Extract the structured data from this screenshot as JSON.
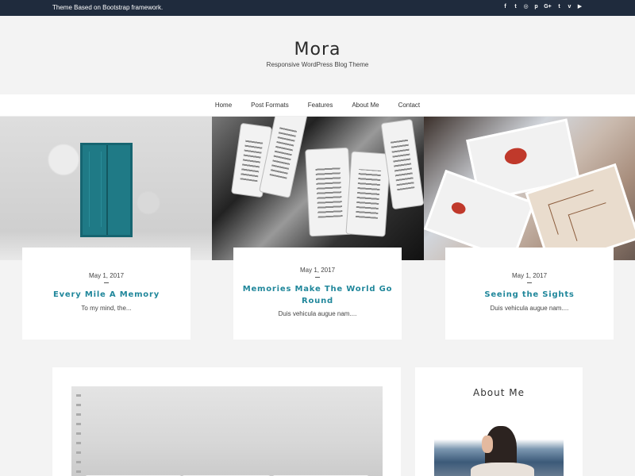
{
  "topbar": {
    "tagline": "Theme Based on Bootstrap framework.",
    "social": [
      {
        "icon": "facebook-icon",
        "glyph": "f"
      },
      {
        "icon": "twitter-icon",
        "glyph": "t"
      },
      {
        "icon": "instagram-icon",
        "glyph": "◎"
      },
      {
        "icon": "pinterest-icon",
        "glyph": "p"
      },
      {
        "icon": "google-plus-icon",
        "glyph": "G+"
      },
      {
        "icon": "tumblr-icon",
        "glyph": "t"
      },
      {
        "icon": "vimeo-icon",
        "glyph": "v"
      },
      {
        "icon": "youtube-icon",
        "glyph": "▶"
      }
    ]
  },
  "header": {
    "title": "Mora",
    "description": "Responsive WordPress Blog Theme"
  },
  "nav": {
    "items": [
      "Home",
      "Post Formats",
      "Features",
      "About Me",
      "Contact"
    ]
  },
  "featured": [
    {
      "date": "May 1, 2017",
      "title": "Every Mile A Memory",
      "excerpt": "To my mind, the..."
    },
    {
      "date": "May 1, 2017",
      "title": "Memories Make The World Go Round",
      "excerpt": "Duis vehicula augue nam...."
    },
    {
      "date": "May 1, 2017",
      "title": "Seeing the Sights",
      "excerpt": "Duis vehicula augue nam...."
    }
  ],
  "sidebar": {
    "widget_title": "About Me"
  },
  "colors": {
    "topbar_bg": "#1f2b3d",
    "accent": "#20879b",
    "page_bg": "#f3f3f3"
  }
}
